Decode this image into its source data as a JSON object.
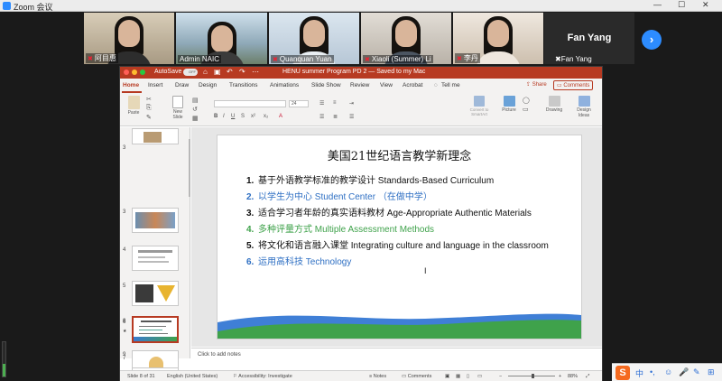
{
  "zoom": {
    "app_title": "Zoom 会议",
    "win_min": "—",
    "win_max": "☐",
    "win_close": "✕"
  },
  "participants": [
    {
      "name": "阿目惠"
    },
    {
      "name": "Admin NAIC"
    },
    {
      "name": "Quanquan Yuan"
    },
    {
      "name": "Xiaoli (Summer) Li"
    },
    {
      "name": "李丹"
    }
  ],
  "active_speaker": {
    "display": "Fan Yang",
    "label": "Fan Yang"
  },
  "next_arrow": "›",
  "ppt": {
    "autosave": "AutoSave",
    "autosave_state": "OFF",
    "doc_title": "HENU summer Program PD 2 — Saved to my Mac",
    "tabs": [
      "Home",
      "Insert",
      "Draw",
      "Design",
      "Transitions",
      "Animations",
      "Slide Show",
      "Review",
      "View",
      "Acrobat",
      "Tell me"
    ],
    "share": "Share",
    "comments_btn": "Comments",
    "ribbon": {
      "paste": "Paste",
      "new_slide": "New Slide",
      "font_size": "24",
      "convert": "Convert to SmartArt",
      "picture": "Picture",
      "drawing": "Drawing",
      "design_ideas": "Design Ideas"
    },
    "thumb_numbers": [
      "3",
      "4",
      "5",
      "6",
      "7",
      "8",
      "9"
    ],
    "selected_star": "★",
    "slide": {
      "title": "美国21世纪语言教学新理念",
      "points": [
        {
          "num": "1.",
          "text": "基于外语教学标准的教学设计 Standards-Based Curriculum"
        },
        {
          "num": "2.",
          "text": "以学生为中心 Student Center （在做中学）"
        },
        {
          "num": "3.",
          "text": "适合学习者年龄的真实语料教材 Age-Appropriate Authentic Materials"
        },
        {
          "num": "4.",
          "text": "多种评量方式 Multiple Assessment Methods"
        },
        {
          "num": "5.",
          "text": "将文化和语言融入课堂 Integrating culture and language in the classroom"
        },
        {
          "num": "6.",
          "text": "运用高科技 Technology"
        }
      ]
    },
    "notes_placeholder": "Click to add notes",
    "status": {
      "slide": "Slide 8 of 31",
      "language": "English (United States)",
      "accessibility": "Accessibility: Investigate",
      "notes": "Notes",
      "comments": "Comments",
      "zoom": "88%"
    }
  },
  "ime": {
    "logo": "S",
    "lang": "中",
    "items": [
      "•,",
      "☺",
      "🎤",
      "✎",
      "⊞"
    ]
  }
}
